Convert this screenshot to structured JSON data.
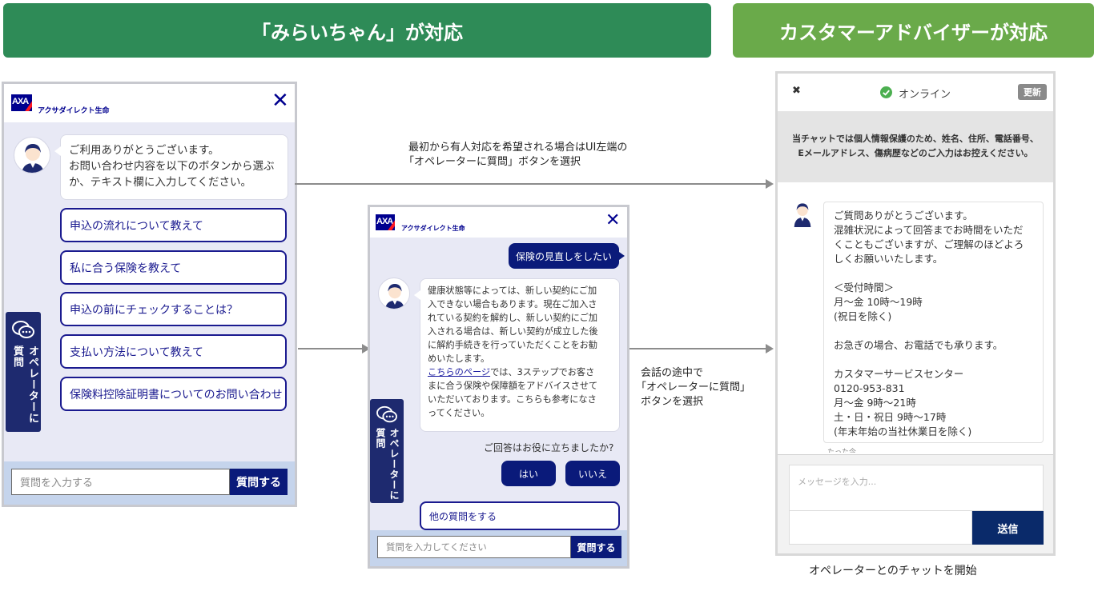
{
  "banners": {
    "left": "「みらいちゃん」が対応",
    "right": "カスタマーアドバイザーが対応"
  },
  "brand": {
    "name": "アクサダイレクト生命",
    "logo_text": "AXA"
  },
  "panel1": {
    "greeting_lines": [
      "ご利用ありがとうございます。",
      "お問い合わせ内容を以下のボタンから選ぶ",
      "か、テキスト欄に入力してください。"
    ],
    "options": [
      "申込の流れについて教えて",
      "私に合う保険を教えて",
      "申込の前にチェックすることは？",
      "支払い方法について教えて",
      "保険料控除証明書についてのお問い合わせ"
    ],
    "side_tab": "オペレーターに質問",
    "input_placeholder": "質問を入力する",
    "submit_label": "質問する"
  },
  "panel2": {
    "user_message": "保険の見直しをしたい",
    "bot_lines": [
      "健康状態等によっては、新しい契約にご加",
      "入できない場合もあります。現在ご加入さ",
      "れている契約を解約し、新しい契約にご加",
      "入される場合は、新しい契約が成立した後",
      "に解約手続きを行っていただくことをお勧",
      "めいたします。"
    ],
    "link_text": "こちらのページ",
    "after_link_lines": [
      "では、3ステップでお客さ",
      "まに合う保険や保障額をアドバイスさせて",
      "いただいております。こちらも参考になさ",
      "ってください。"
    ],
    "feedback_question": "ご回答はお役に立ちましたか?",
    "yes_label": "はい",
    "no_label": "いいえ",
    "other_question": "他の質問をする",
    "side_tab": "オペレーターに質問",
    "input_placeholder": "質問を入力してください",
    "submit_label": "質問する"
  },
  "notes": {
    "top_line1": "最初から有人対応を希望される場合はUI左端の",
    "top_line2": "「オペレーターに質問」ボタンを選択",
    "mid_line1": "会話の途中で",
    "mid_line2": "「オペレーターに質問」",
    "mid_line3": "ボタンを選択",
    "bottom": "オペレーターとのチャットを開始"
  },
  "panel3": {
    "close_symbol": "✖",
    "status": "オンライン",
    "refresh_label": "更新",
    "notice_line1": "当チャットでは個人情報保護のため、姓名、住所、電話番号、",
    "notice_line2": "Eメールアドレス、傷病歴などのご入力はお控えください。",
    "message_lines": [
      "ご質問ありがとうございます。",
      "混雑状況によって回答までお時間をいただ",
      "くこともございますが、ご理解のほどよろ",
      "しくお願いいたします。",
      "",
      "＜受付時間＞",
      "月〜金 10時〜19時",
      "(祝日を除く)",
      "",
      "お急ぎの場合、お電話でも承ります。",
      "",
      "カスタマーサービスセンター",
      "0120-953-831",
      "月〜金 9時〜21時",
      "土・日・祝日 9時〜17時",
      "(年末年始の当社休業日を除く)"
    ],
    "timestamp": "たった今",
    "input_placeholder": "メッセージを入力...",
    "send_label": "送信"
  },
  "colors": {
    "banner_left": "#2e8b57",
    "banner_right": "#6aaa4a",
    "navy": "#0a1a7a",
    "axa_blue": "#00008f",
    "axa_red": "#ff1721",
    "online_green": "#4caf50"
  }
}
